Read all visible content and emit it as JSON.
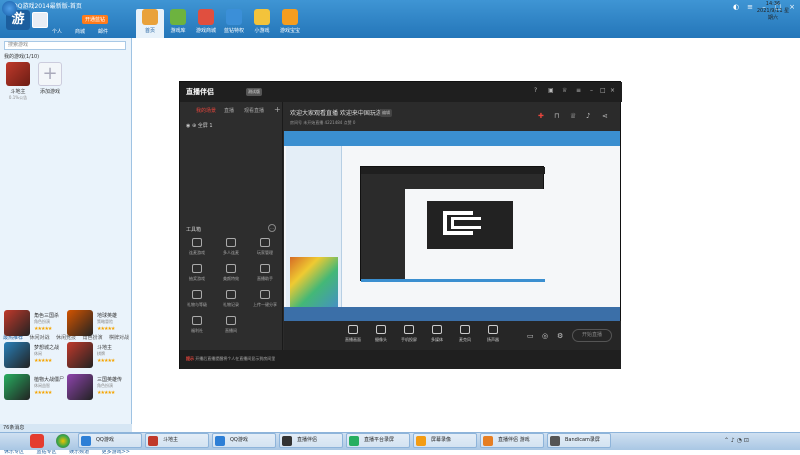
{
  "outer": {
    "title": "QQ游戏2014最新版-首页",
    "logo": "游",
    "vip_label": "开通蓝钻",
    "user_links": [
      "个人",
      "商城",
      "邮件"
    ],
    "win_controls": [
      "皮肤",
      "菜单",
      "最小化",
      "最大化",
      "关闭"
    ],
    "nav_tabs": [
      {
        "label": "首页",
        "color": "#e9a23b"
      },
      {
        "label": "游戏库",
        "color": "#6db33f"
      },
      {
        "label": "游戏商城",
        "color": "#e04f3f"
      },
      {
        "label": "蓝钻特权",
        "color": "#3b8fd8"
      },
      {
        "label": "小游戏",
        "color": "#f3c33b"
      },
      {
        "label": "游戏宝宝",
        "color": "#f59d1f"
      }
    ]
  },
  "left": {
    "search_placeholder": "搜索游戏",
    "my_games_label": "我的游戏(1/10)",
    "games": [
      {
        "name": "斗地主",
        "sub": "0.1%公告"
      },
      {
        "name": "添加游戏",
        "sub": ""
      }
    ],
    "subtabs": [
      "最热推荐",
      "休闲对战",
      "休闲竞技",
      "角色扮演",
      "棋牌对战"
    ],
    "recommended": [
      {
        "name": "角色三国杀",
        "type": "角色扮演",
        "stars": "★★★★★",
        "color": "#c0392b"
      },
      {
        "name": "地球英雄",
        "type": "策略冒险",
        "stars": "★★★★★",
        "color": "#d35400"
      },
      {
        "name": "梦想城之战",
        "type": "休闲",
        "stars": "★★★★★",
        "color": "#2980b9"
      },
      {
        "name": "斗地主",
        "type": "棋牌",
        "stars": "★★★★★",
        "color": "#c0392b"
      },
      {
        "name": "植物大战僵尸",
        "type": "休闲益智",
        "stars": "★★★★★",
        "color": "#27ae60"
      },
      {
        "name": "三国英雄传",
        "type": "角色扮演",
        "stars": "★★★★★",
        "color": "#8e44ad"
      }
    ],
    "bottom_links": [
      "休乐专区",
      "蓝钻专区",
      "娱乐频道",
      "更多游戏>>"
    ],
    "status": "76条消息"
  },
  "zhibo": {
    "logo_text": "直播伴侣",
    "version": "测试版",
    "left_tabs": [
      "我的场景",
      "直播",
      "观看直播"
    ],
    "scene_label": "全屏 1",
    "tools_label": "工具箱",
    "tools": [
      "连麦游戏",
      "多人连麦",
      "玩家管理",
      "抽奖游戏",
      "美颜特效",
      "直播助手",
      "礼物与等级",
      "礼物记录",
      "上传一键分享",
      "福利社",
      "直播间"
    ],
    "room_title": "欢迎大家观看直播 欢迎来中国玩游戏",
    "edit_label": "编辑",
    "room_info": "房间号  未开始直播  4221484  点赞 0",
    "controls": [
      "直播画面",
      "摄像头",
      "手机投屏",
      "多媒体",
      "麦克风",
      "扬声器"
    ],
    "start_button": "开始直播",
    "notice": "开播后直播提醒将个人在直播间显示到房间里",
    "notice_tag": "提示"
  },
  "taskbar": {
    "tasks": [
      {
        "label": "QQ游戏",
        "color": "#2d7fd6"
      },
      {
        "label": "斗地主",
        "color": "#c0392b"
      },
      {
        "label": "QQ游戏",
        "color": "#2d7fd6"
      },
      {
        "label": "直播伴侣",
        "color": "#333333"
      },
      {
        "label": "直播平台录屏",
        "color": "#27ae60"
      },
      {
        "label": "屏幕录像",
        "color": "#f39c12"
      },
      {
        "label": "直播伴侣 游戏",
        "color": "#e67e22"
      },
      {
        "label": "Bandicam录屏",
        "color": "#555555"
      }
    ],
    "time": "14:36",
    "date": "2021/9/11 星期六"
  }
}
